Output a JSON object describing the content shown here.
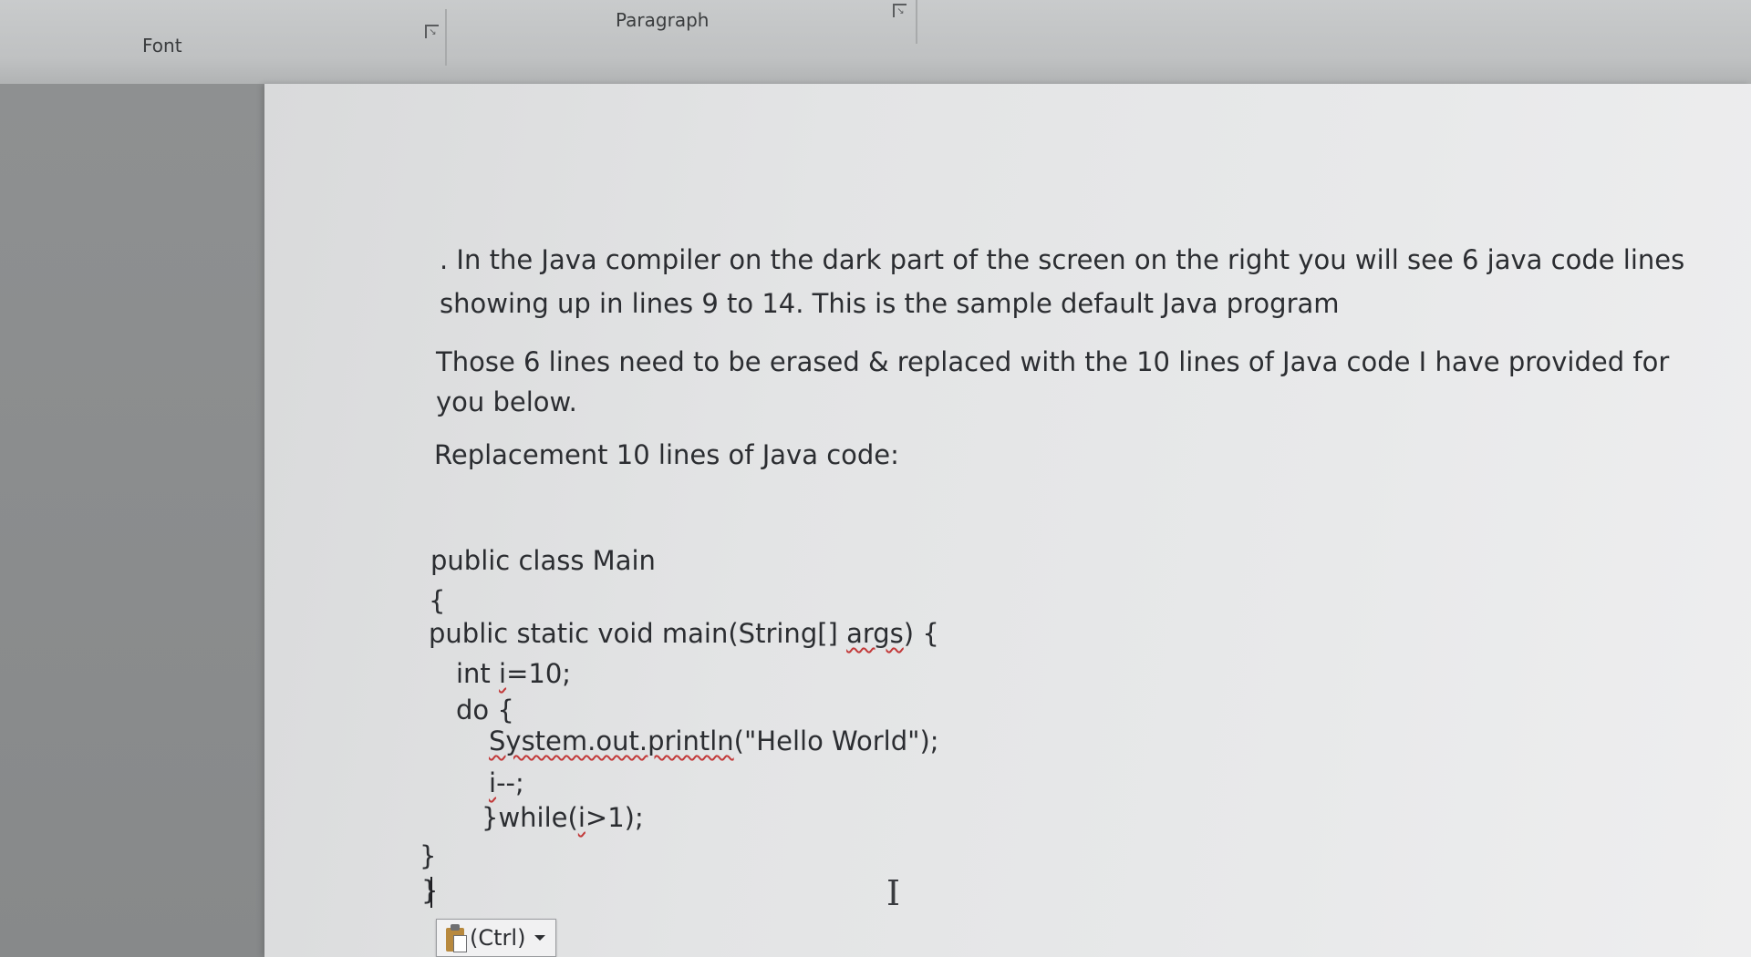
{
  "ribbon": {
    "font_group_label": "Font",
    "paragraph_group_label": "Paragraph"
  },
  "document": {
    "paragraph1_line1": ". In the Java compiler on the dark part of the screen on the right you will see 6 java code lines",
    "paragraph1_line2": "showing up in lines 9 to 14. This is the sample default Java program",
    "paragraph2_line1": "Those 6 lines need to be erased & replaced with the 10 lines of Java code I have provided for",
    "paragraph2_line2": "you below.",
    "paragraph3": "Replacement 10 lines of Java code:",
    "code": {
      "line1": "public class Main",
      "line2": "{",
      "line3_prefix": "public static void main(String[] ",
      "line3_args": "args",
      "line3_suffix": ") {",
      "line4_prefix": "int ",
      "line4_var": "i",
      "line4_suffix": "=10;",
      "line5": "do {",
      "line6_call": "System.out.println",
      "line6_args": "(\"Hello World\");",
      "line7_var": "i",
      "line7_suffix": "--;",
      "line8_prefix": "}while(",
      "line8_var": "i",
      "line8_suffix": ">1);",
      "line9": "}",
      "line10": "}"
    }
  },
  "paste_options": {
    "label": "(Ctrl)",
    "icon": "clipboard-paste-icon"
  }
}
